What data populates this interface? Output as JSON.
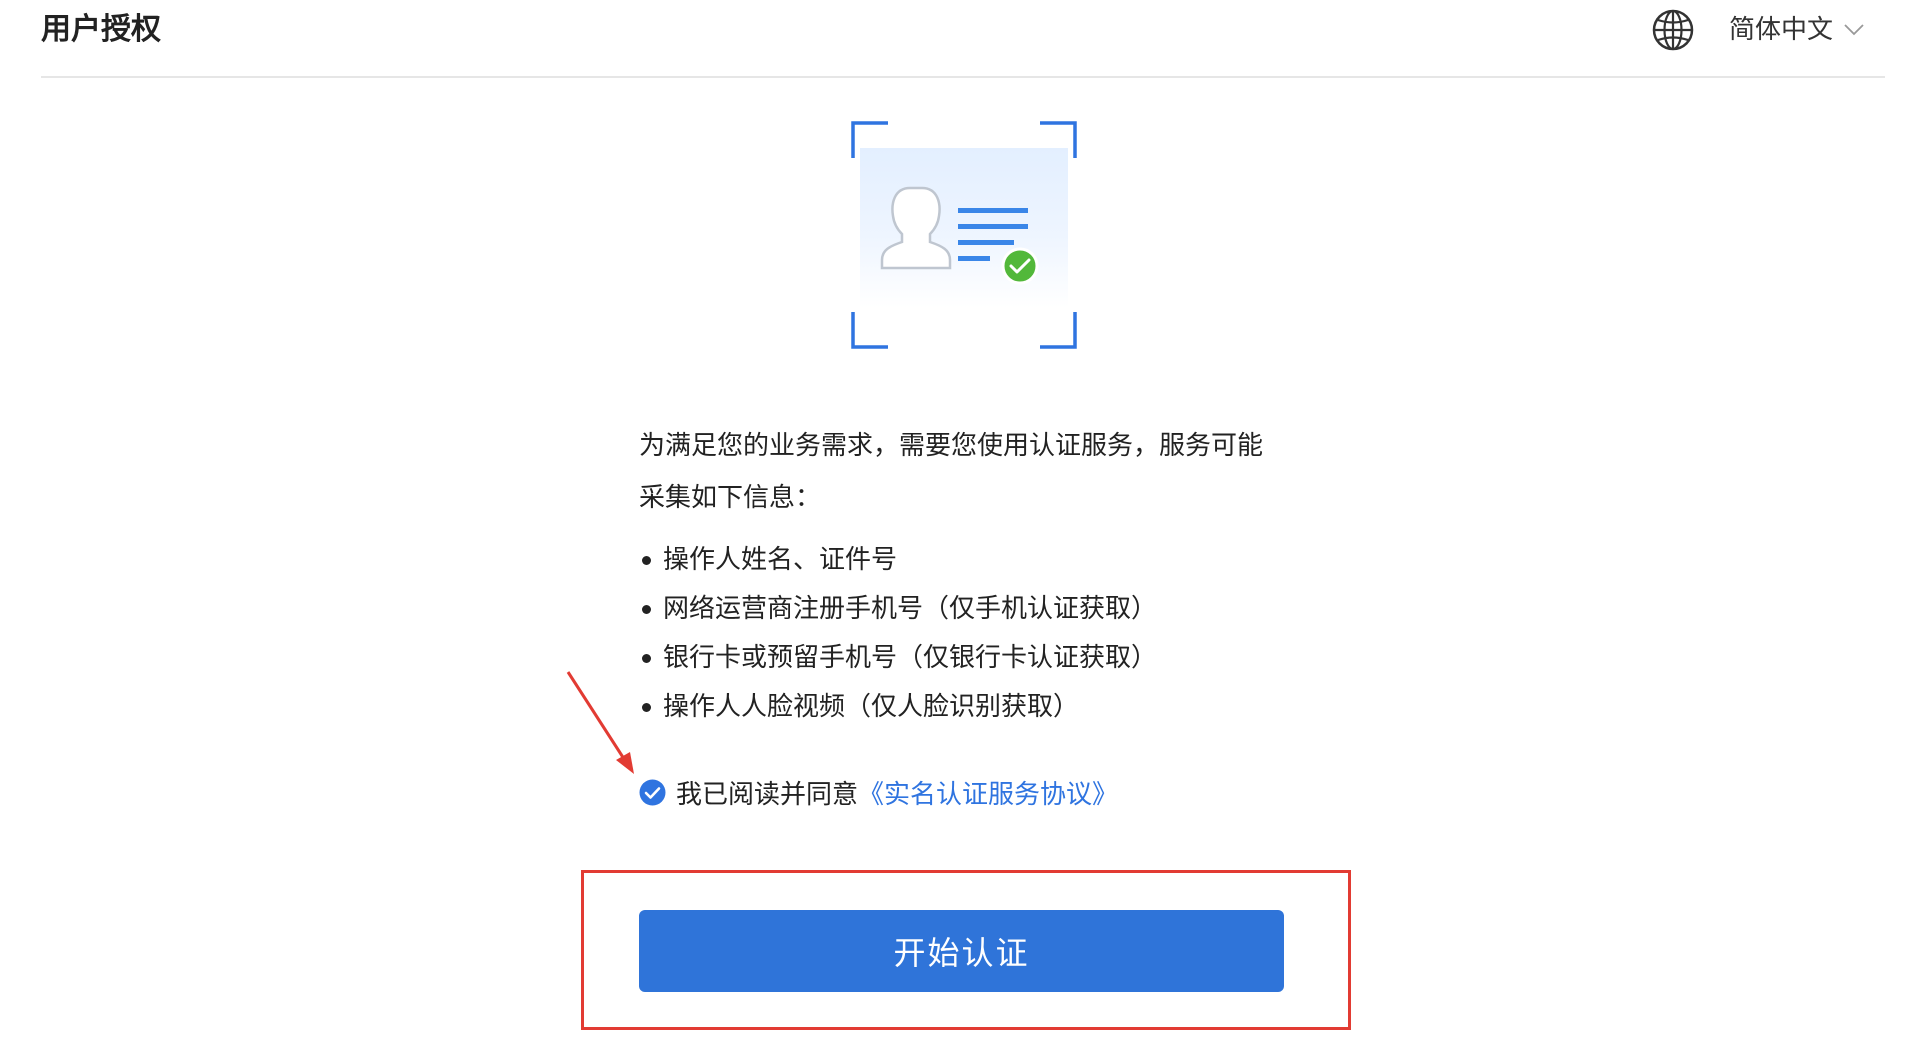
{
  "header": {
    "title": "用户授权",
    "language": "简体中文",
    "globe_icon": "globe-icon",
    "chevron_icon": "chevron-down-icon"
  },
  "illustration": {
    "icon": "id-card-verified-icon"
  },
  "intro": {
    "line1": "为满足您的业务需求，需要您使用认证服务，服务可能",
    "line2": "采集如下信息："
  },
  "info_items": [
    "操作人姓名、证件号",
    "网络运营商注册手机号（仅手机认证获取）",
    "银行卡或预留手机号（仅银行卡认证获取）",
    "操作人人脸视频（仅人脸识别获取）"
  ],
  "agreement": {
    "checked": true,
    "prefix": "我已阅读并同意",
    "link_label": "《实名认证服务协议》"
  },
  "start_button": {
    "label": "开始认证"
  },
  "colors": {
    "primary": "#2f74d9",
    "link": "#2f74e0",
    "annotation": "#e23b33",
    "success": "#52b83a"
  }
}
